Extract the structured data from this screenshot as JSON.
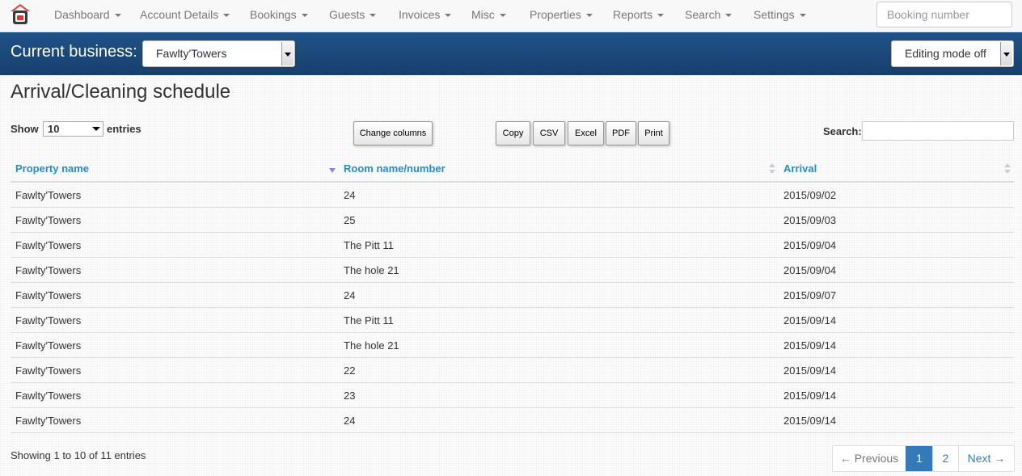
{
  "nav": {
    "items": [
      {
        "label": "Dashboard"
      },
      {
        "label": "Account Details"
      },
      {
        "label": "Bookings"
      },
      {
        "label": "Guests"
      },
      {
        "label": "Invoices"
      },
      {
        "label": "Misc"
      },
      {
        "label": "Properties"
      },
      {
        "label": "Reports"
      },
      {
        "label": "Search"
      },
      {
        "label": "Settings"
      }
    ],
    "booking_placeholder": "Booking number"
  },
  "business": {
    "label": "Current business:",
    "selected": "Fawlty'Towers",
    "editing_mode": "Editing mode off"
  },
  "page": {
    "title": "Arrival/Cleaning schedule",
    "show_label": "Show",
    "entries_label": "entries",
    "length_value": "10",
    "search_label": "Search:",
    "buttons": {
      "change_columns": "Change columns",
      "copy": "Copy",
      "csv": "CSV",
      "excel": "Excel",
      "pdf": "PDF",
      "print": "Print"
    }
  },
  "table": {
    "headers": [
      "Property name",
      "Room name/number",
      "Arrival"
    ],
    "rows": [
      [
        "Fawlty'Towers",
        "24",
        "2015/09/02"
      ],
      [
        "Fawlty'Towers",
        "25",
        "2015/09/03"
      ],
      [
        "Fawlty'Towers",
        "The Pitt 11",
        "2015/09/04"
      ],
      [
        "Fawlty'Towers",
        "The hole 21",
        "2015/09/04"
      ],
      [
        "Fawlty'Towers",
        "24",
        "2015/09/07"
      ],
      [
        "Fawlty'Towers",
        "The Pitt 11",
        "2015/09/14"
      ],
      [
        "Fawlty'Towers",
        "The hole 21",
        "2015/09/14"
      ],
      [
        "Fawlty'Towers",
        "22",
        "2015/09/14"
      ],
      [
        "Fawlty'Towers",
        "23",
        "2015/09/14"
      ],
      [
        "Fawlty'Towers",
        "24",
        "2015/09/14"
      ]
    ]
  },
  "footer": {
    "info": "Showing 1 to 10 of 11 entries",
    "pagination": {
      "previous": "← Previous",
      "pages": [
        "1",
        "2"
      ],
      "active_page": "1",
      "next": "Next →"
    }
  },
  "colors": {
    "navbar_bg": "#f8f8f8",
    "business_bar": "#1a4a7e",
    "link": "#2a8ac9",
    "active_page": "#337ab7"
  }
}
